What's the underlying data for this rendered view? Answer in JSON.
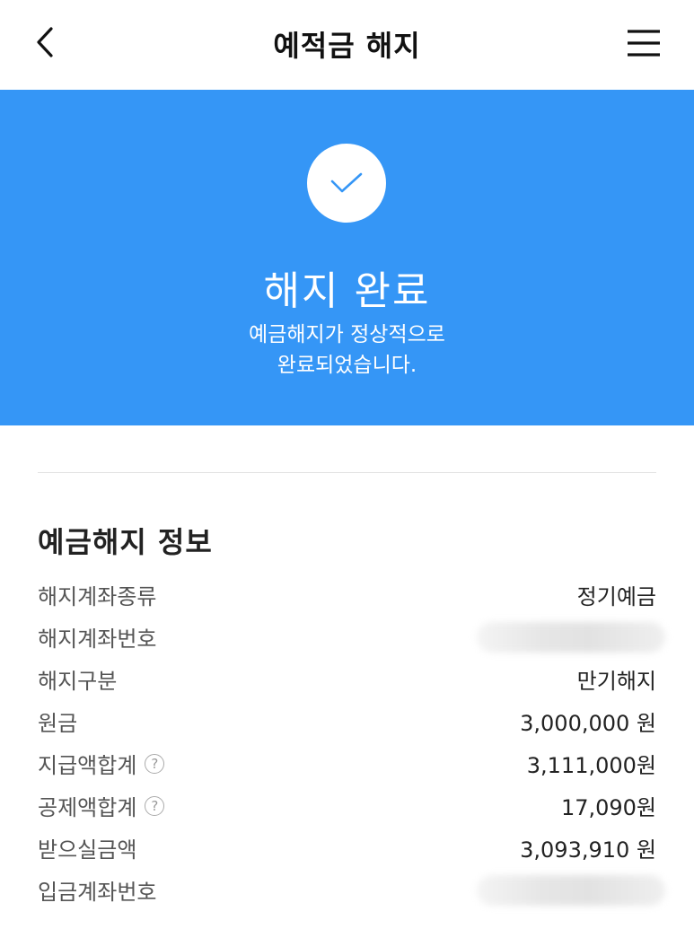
{
  "header": {
    "title": "예적금 해지"
  },
  "banner": {
    "title": "해지 완료",
    "message_line1": "예금해지가 정상적으로",
    "message_line2": "완료되었습니다.",
    "background_color": "#3596f6",
    "check_color": "#3596f6"
  },
  "info": {
    "title": "예금해지 정보",
    "rows": [
      {
        "label": "해지계좌종류",
        "value": "정기예금",
        "help": false
      },
      {
        "label": "해지계좌번호",
        "value": "",
        "help": false,
        "redacted": true
      },
      {
        "label": "해지구분",
        "value": "만기해지",
        "help": false
      },
      {
        "label": "원금",
        "value": "3,000,000 원",
        "help": false
      },
      {
        "label": "지급액합계",
        "value": "3,111,000원",
        "help": true
      },
      {
        "label": "공제액합계",
        "value": "17,090원",
        "help": true
      },
      {
        "label": "받으실금액",
        "value": "3,093,910 원",
        "help": false
      },
      {
        "label": "입금계좌번호",
        "value": "",
        "help": false,
        "redacted": true
      }
    ],
    "help_glyph": "?"
  },
  "icons": {
    "back": "chevron-left-icon",
    "menu": "hamburger-menu-icon",
    "check": "checkmark-icon",
    "help": "question-circle-icon"
  }
}
